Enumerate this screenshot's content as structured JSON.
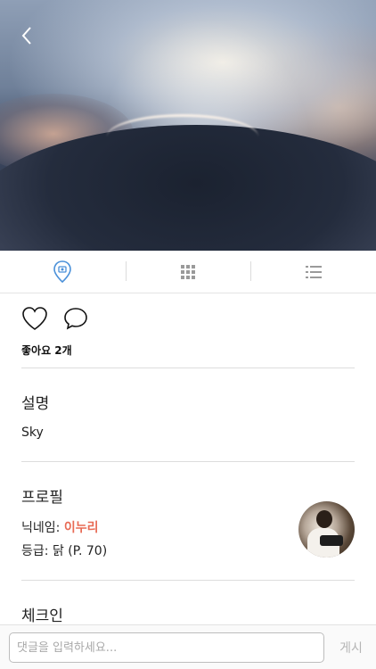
{
  "hero": {
    "image": "sky-clouds-photo",
    "back_icon": "chevron-left-icon"
  },
  "tabs": [
    {
      "icon": "map-pin-icon",
      "active": true,
      "color": "#4a90d9"
    },
    {
      "icon": "grid-icon",
      "active": false
    },
    {
      "icon": "list-icon",
      "active": false
    }
  ],
  "actions": {
    "like_icon": "heart-icon",
    "comment_icon": "comment-bubble-icon"
  },
  "likes_text": "좋아요 2개",
  "description": {
    "title": "설명",
    "text": "Sky"
  },
  "profile": {
    "title": "프로필",
    "nickname_label": "닉네임:",
    "nickname_value": "이누리",
    "grade_label": "등급:",
    "grade_value": "닭 (P. 70)",
    "nickname_color": "#e86b55"
  },
  "checkin": {
    "title": "체크인"
  },
  "comment": {
    "placeholder": "댓글을 입력하세요...",
    "value": "",
    "post_label": "게시"
  }
}
